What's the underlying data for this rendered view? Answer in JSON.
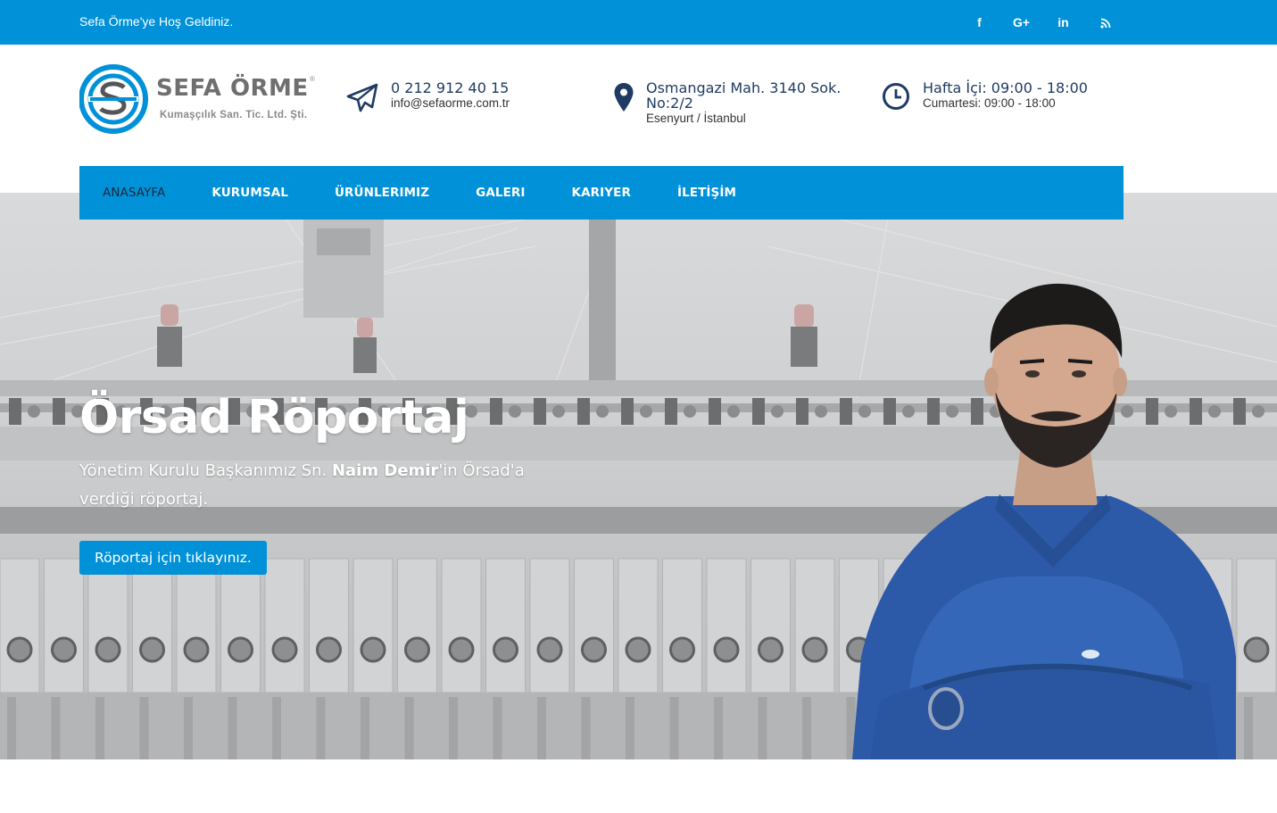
{
  "topbar": {
    "welcome": "Sefa Örme'ye Hoş Geldiniz.",
    "social": [
      {
        "icon": "facebook-icon",
        "glyph": "f"
      },
      {
        "icon": "google-plus-icon",
        "glyph": "G+"
      },
      {
        "icon": "linkedin-icon",
        "glyph": "in"
      },
      {
        "icon": "rss-icon",
        "glyph": ""
      }
    ],
    "color": "#0091d9"
  },
  "logo": {
    "brand": "SEFA ÖRME",
    "registered": "®",
    "subtitle": "Kumaşçılık San. Tic. Ltd. Şti."
  },
  "contact": {
    "phone": "0 212 912 40 15",
    "email": "info@sefaorme.com.tr",
    "address_line1": "Osmangazi Mah. 3140 Sok.",
    "address_line2": "No:2/2",
    "address_line3": "Esenyurt / İstanbul",
    "hours_weekday": "Hafta İçi: 09:00 - 18:00",
    "hours_saturday": "Cumartesi: 09:00 - 18:00"
  },
  "nav": {
    "items": [
      {
        "label": "ANASAYFA",
        "active": true
      },
      {
        "label": "KURUMSAL",
        "active": false
      },
      {
        "label": "ÜRÜNLERIMIZ",
        "active": false
      },
      {
        "label": "GALERI",
        "active": false
      },
      {
        "label": "KARIYER",
        "active": false
      },
      {
        "label": "İLETİŞİM",
        "active": false
      }
    ]
  },
  "hero": {
    "title": "Örsad Röportaj",
    "desc_before": "Yönetim Kurulu Başkanımız Sn. ",
    "desc_name": "Naim Demir",
    "desc_after": "'in Örsad'a verdiği röportaj.",
    "cta": "Röportaj için tıklayınız."
  },
  "colors": {
    "accent": "#0091d9",
    "dark_text": "#1f3b63"
  }
}
